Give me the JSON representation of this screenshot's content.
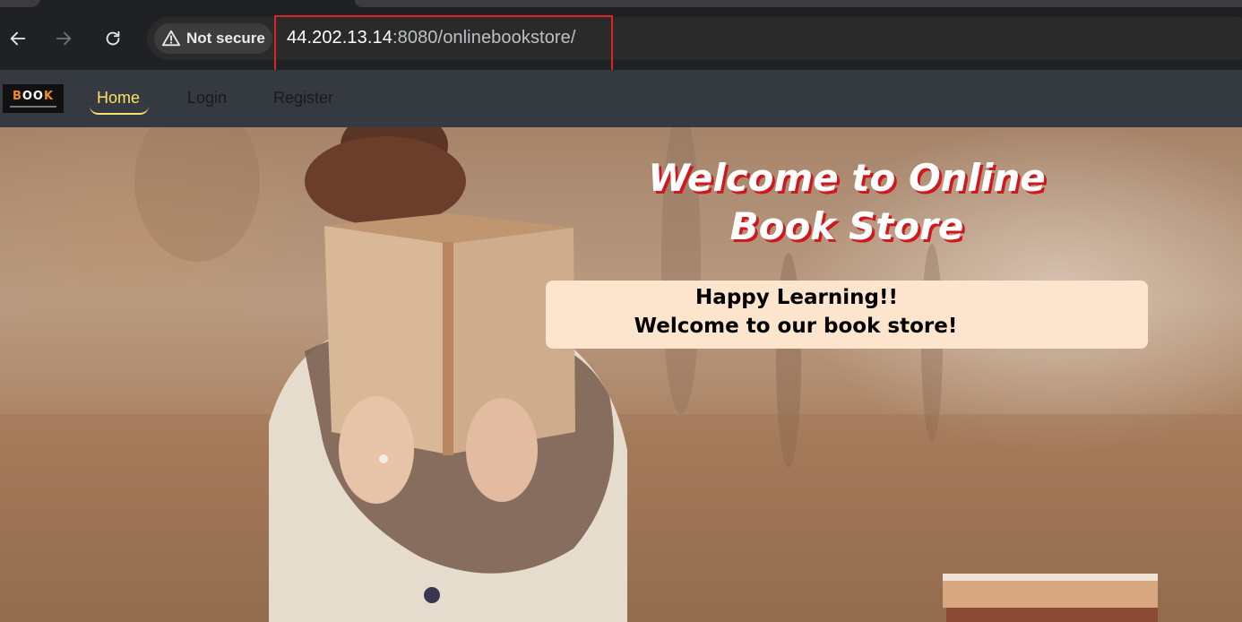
{
  "browser": {
    "security_label": "Not secure",
    "url_host": "44.202.13.14",
    "url_rest": ":8080/onlinebookstore/",
    "annotation_color": "#d9262b"
  },
  "site": {
    "logo_text_left": "B",
    "logo_text_book": "OO",
    "logo_text_right": "K",
    "nav": {
      "home": "Home",
      "login": "Login",
      "register": "Register"
    },
    "active_color": "#ffe066",
    "navbar_color": "#343a40"
  },
  "hero": {
    "title_line1": "Welcome to Online",
    "title_line2": "Book Store",
    "card_line1": "Happy Learning!!",
    "card_line2": "Welcome to our book store!",
    "card_color": "#fde4cc",
    "title_shadow_color": "#d1161c"
  },
  "icons": [
    "back-arrow-icon",
    "forward-arrow-icon",
    "reload-icon",
    "warning-icon",
    "book-logo-icon"
  ]
}
